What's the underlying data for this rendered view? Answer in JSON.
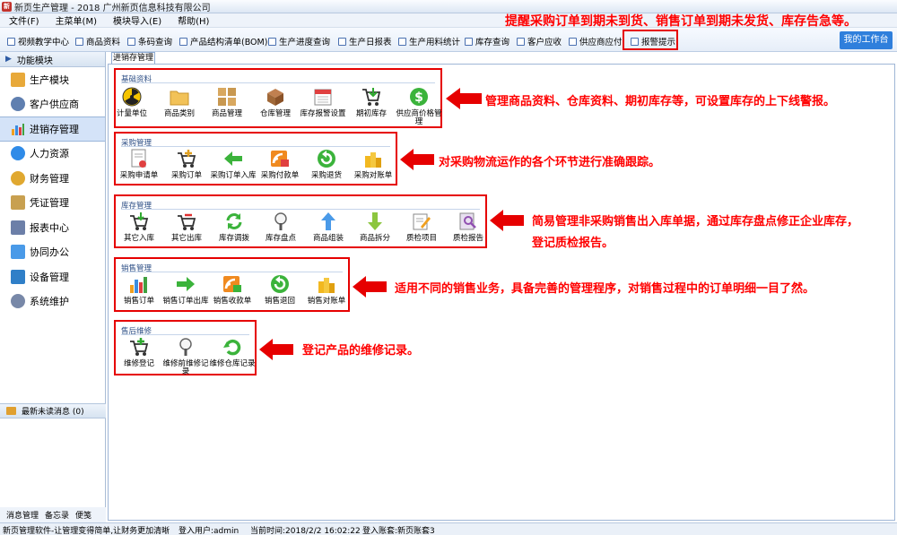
{
  "window": {
    "title": "新页生产管理 - 2018 广州新页信息科技有限公司",
    "app_icon_text": "新"
  },
  "menubar": [
    {
      "label": "文件(F)"
    },
    {
      "label": "主菜单(M)"
    },
    {
      "label": "模块导入(E)"
    },
    {
      "label": "帮助(H)"
    }
  ],
  "top_annotation": "提醒采购订单到期未到货、销售订单到期未发货、库存告急等。",
  "quickbar": [
    {
      "label": "视频教学中心"
    },
    {
      "label": "商品资料"
    },
    {
      "label": "条码查询"
    },
    {
      "label": "产品结构清单(BOM)"
    },
    {
      "label": "生产进度查询"
    },
    {
      "label": "生产日报表"
    },
    {
      "label": "生产用料统计"
    },
    {
      "label": "库存查询"
    },
    {
      "label": "客户应收"
    },
    {
      "label": "供应商应付"
    },
    {
      "label": "报警提示"
    }
  ],
  "workbench_label": "我的工作台",
  "sidebar": {
    "header": "功能模块",
    "items": [
      {
        "label": "生产模块",
        "icon": "folder-icon",
        "color": "#e8a93a"
      },
      {
        "label": "客户供应商",
        "icon": "user-group-icon",
        "color": "#5f7fb0"
      },
      {
        "label": "进销存管理",
        "icon": "bar-chart-icon",
        "color": "#3a8de0"
      },
      {
        "label": "人力资源",
        "icon": "person-icon",
        "color": "#2f8be8"
      },
      {
        "label": "财务管理",
        "icon": "coins-icon",
        "color": "#e0a830"
      },
      {
        "label": "凭证管理",
        "icon": "notepad-icon",
        "color": "#c8a050"
      },
      {
        "label": "报表中心",
        "icon": "report-icon",
        "color": "#6c7fa8"
      },
      {
        "label": "协同办公",
        "icon": "document-icon",
        "color": "#4a9ae8"
      },
      {
        "label": "设备管理",
        "icon": "device-icon",
        "color": "#2f7fc8"
      },
      {
        "label": "系统维护",
        "icon": "gear-icon",
        "color": "#7888a8"
      }
    ],
    "messages": "最新未读消息 (0)",
    "footer": [
      "消息管理",
      "备忘录",
      "便笺"
    ]
  },
  "tab_label": "进销存管理",
  "groups": [
    {
      "title": "基础资料",
      "annotation": "管理商品资料、仓库资料、期初库存等，可设置库存的上下线警报。",
      "buttons": [
        {
          "label": "计量单位",
          "icon": "radiation-icon"
        },
        {
          "label": "商品类别",
          "icon": "folder-icon"
        },
        {
          "label": "商品管理",
          "icon": "grid-icon"
        },
        {
          "label": "仓库管理",
          "icon": "warehouse-box-icon"
        },
        {
          "label": "库存报警设置",
          "icon": "calendar-icon"
        },
        {
          "label": "期初库存",
          "icon": "cart-icon"
        },
        {
          "label": "供应商价格管理",
          "icon": "dollar-icon"
        }
      ]
    },
    {
      "title": "采购管理",
      "annotation": "对采购物流运作的各个环节进行准确跟踪。",
      "buttons": [
        {
          "label": "采购申请单",
          "icon": "request-form-icon"
        },
        {
          "label": "采购订单",
          "icon": "cart-plus-icon"
        },
        {
          "label": "采购订单入库",
          "icon": "arrow-left-icon"
        },
        {
          "label": "采购付款单",
          "icon": "payment-icon"
        },
        {
          "label": "采购退货",
          "icon": "return-icon"
        },
        {
          "label": "采购对账单",
          "icon": "coin-stack-icon"
        }
      ]
    },
    {
      "title": "库存管理",
      "annotation": "简易管理非采购销售出入库单据，通过库存盘点修正企业库存，",
      "annotation_line2": "登记质检报告。",
      "buttons": [
        {
          "label": "其它入库",
          "icon": "cart-in-icon"
        },
        {
          "label": "其它出库",
          "icon": "cart-out-icon"
        },
        {
          "label": "库存调拨",
          "icon": "refresh-icon"
        },
        {
          "label": "库存盘点",
          "icon": "magnifier-icon"
        },
        {
          "label": "商品组装",
          "icon": "arrow-up-icon"
        },
        {
          "label": "商品拆分",
          "icon": "arrow-down-icon"
        },
        {
          "label": "质检项目",
          "icon": "edit-icon"
        },
        {
          "label": "质检报告",
          "icon": "search-report-icon"
        }
      ]
    },
    {
      "title": "销售管理",
      "annotation": "适用不同的销售业务，具备完善的管理程序，对销售过程中的订单明细一目了然。",
      "buttons": [
        {
          "label": "销售订单",
          "icon": "bar-chart-icon"
        },
        {
          "label": "销售订单出库",
          "icon": "arrow-right-icon"
        },
        {
          "label": "销售收款单",
          "icon": "receipt-icon"
        },
        {
          "label": "销售退回",
          "icon": "return-icon"
        },
        {
          "label": "销售对账单",
          "icon": "coin-stack-icon"
        }
      ]
    },
    {
      "title": "售后维修",
      "annotation": "登记产品的维修记录。",
      "buttons": [
        {
          "label": "维修登记",
          "icon": "cart-icon"
        },
        {
          "label": "维修前维修记录",
          "icon": "magnifier-icon"
        },
        {
          "label": "维修仓库记录",
          "icon": "refresh-icon"
        }
      ]
    }
  ],
  "statusbar": {
    "slogan": "新页管理软件-让管理变得简单,让财务更加清晰",
    "user": "登入用户:admin",
    "time": "当前时间:2018/2/2 16:02:22",
    "account": "登入账套:新页账套3"
  },
  "colors": {
    "annotation": "#ff0000",
    "accent": "#2f7fdc",
    "group_border": "#e60000"
  }
}
